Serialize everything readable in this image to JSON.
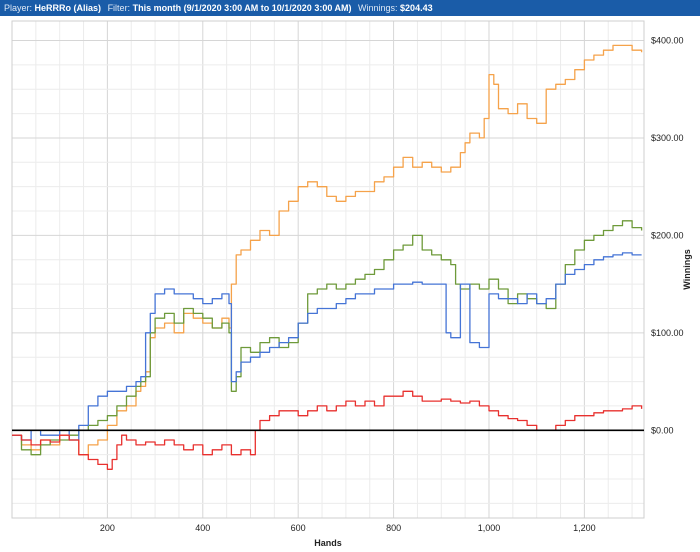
{
  "header": {
    "player_label": "Player:",
    "player_value": "HeRRRo (Alias)",
    "filter_label": "Filter:",
    "filter_value": "This month (9/1/2020 3:00 AM to 10/1/2020 3:00 AM)",
    "winnings_label": "Winnings:",
    "winnings_value": "$204.43"
  },
  "colors": {
    "header_bg": "#1a5ca8",
    "orange": "#f5a24a",
    "green": "#6e9a3a",
    "blue": "#4574d6",
    "red": "#e8302e",
    "zero_line": "#000000"
  },
  "chart_data": {
    "type": "line",
    "xlabel": "Hands",
    "ylabel": "Winnings",
    "xlim": [
      0,
      1325
    ],
    "ylim": [
      -90,
      420
    ],
    "x_ticks": [
      200,
      400,
      600,
      800,
      1000,
      1200
    ],
    "x_tick_labels": [
      "200",
      "400",
      "600",
      "800",
      "1,000",
      "1,200"
    ],
    "y_ticks": [
      0,
      100,
      200,
      300,
      400
    ],
    "y_tick_labels": [
      "$0.00",
      "$100.00",
      "$200.00",
      "$300.00",
      "$400.00"
    ],
    "grid": true,
    "y_axis_side": "right",
    "series": [
      {
        "color": "#f5a24a",
        "x": [
          0,
          20,
          40,
          60,
          80,
          100,
          120,
          140,
          160,
          180,
          200,
          220,
          240,
          260,
          270,
          280,
          290,
          300,
          320,
          340,
          360,
          380,
          400,
          420,
          440,
          455,
          460,
          470,
          480,
          500,
          520,
          540,
          560,
          580,
          600,
          620,
          640,
          660,
          680,
          700,
          720,
          740,
          760,
          780,
          800,
          820,
          840,
          860,
          880,
          900,
          920,
          940,
          950,
          960,
          980,
          990,
          1000,
          1010,
          1020,
          1040,
          1060,
          1080,
          1100,
          1120,
          1140,
          1160,
          1180,
          1200,
          1220,
          1240,
          1260,
          1280,
          1300,
          1320
        ],
        "y": [
          -5,
          -15,
          -20,
          -10,
          -15,
          -5,
          -10,
          -25,
          -15,
          -10,
          5,
          20,
          25,
          40,
          45,
          60,
          95,
          105,
          110,
          100,
          120,
          115,
          110,
          105,
          115,
          105,
          150,
          180,
          185,
          195,
          205,
          200,
          225,
          235,
          250,
          255,
          250,
          240,
          235,
          240,
          245,
          245,
          255,
          260,
          270,
          280,
          270,
          275,
          270,
          265,
          270,
          285,
          295,
          305,
          300,
          320,
          365,
          355,
          330,
          325,
          335,
          320,
          315,
          350,
          355,
          360,
          370,
          380,
          385,
          390,
          395,
          395,
          390,
          388
        ]
      },
      {
        "color": "#6e9a3a",
        "x": [
          0,
          20,
          40,
          60,
          80,
          100,
          120,
          140,
          160,
          180,
          200,
          220,
          240,
          260,
          270,
          280,
          290,
          300,
          320,
          340,
          360,
          380,
          400,
          420,
          440,
          455,
          460,
          470,
          480,
          500,
          520,
          540,
          560,
          580,
          600,
          620,
          640,
          660,
          680,
          700,
          720,
          740,
          760,
          780,
          800,
          820,
          840,
          860,
          880,
          900,
          920,
          930,
          940,
          960,
          980,
          1000,
          1020,
          1040,
          1060,
          1080,
          1100,
          1120,
          1140,
          1160,
          1180,
          1200,
          1220,
          1240,
          1260,
          1280,
          1300,
          1320
        ],
        "y": [
          -5,
          -20,
          -25,
          -15,
          -10,
          -10,
          -5,
          0,
          5,
          10,
          15,
          25,
          35,
          45,
          50,
          55,
          100,
          115,
          120,
          110,
          125,
          120,
          115,
          105,
          110,
          100,
          40,
          55,
          85,
          80,
          90,
          95,
          85,
          90,
          110,
          140,
          145,
          150,
          145,
          150,
          155,
          160,
          165,
          175,
          185,
          190,
          200,
          185,
          180,
          175,
          170,
          150,
          145,
          150,
          145,
          155,
          145,
          130,
          140,
          135,
          130,
          125,
          150,
          170,
          185,
          195,
          200,
          205,
          210,
          215,
          208,
          205
        ]
      },
      {
        "color": "#4574d6",
        "x": [
          0,
          20,
          40,
          60,
          80,
          100,
          120,
          140,
          160,
          180,
          200,
          220,
          240,
          260,
          270,
          280,
          290,
          300,
          320,
          340,
          360,
          380,
          400,
          420,
          440,
          455,
          460,
          470,
          480,
          500,
          520,
          540,
          560,
          580,
          600,
          620,
          640,
          660,
          680,
          700,
          720,
          740,
          760,
          780,
          800,
          820,
          840,
          860,
          880,
          900,
          910,
          920,
          940,
          960,
          980,
          1000,
          1020,
          1040,
          1060,
          1080,
          1100,
          1120,
          1140,
          1160,
          1180,
          1200,
          1220,
          1240,
          1260,
          1280,
          1300,
          1320
        ],
        "y": [
          -5,
          -10,
          0,
          -5,
          -5,
          0,
          -10,
          5,
          25,
          35,
          40,
          40,
          45,
          50,
          55,
          100,
          120,
          140,
          145,
          140,
          140,
          135,
          130,
          135,
          140,
          130,
          50,
          60,
          70,
          75,
          80,
          85,
          90,
          95,
          110,
          120,
          125,
          125,
          130,
          135,
          140,
          140,
          145,
          145,
          150,
          150,
          152,
          150,
          150,
          150,
          100,
          95,
          150,
          90,
          85,
          140,
          135,
          135,
          130,
          140,
          130,
          135,
          150,
          160,
          165,
          170,
          175,
          178,
          180,
          182,
          180,
          180
        ]
      },
      {
        "color": "#e8302e",
        "x": [
          0,
          20,
          40,
          60,
          80,
          100,
          120,
          140,
          160,
          180,
          200,
          210,
          220,
          230,
          240,
          260,
          280,
          300,
          320,
          340,
          360,
          380,
          400,
          420,
          440,
          460,
          480,
          500,
          510,
          520,
          540,
          560,
          580,
          600,
          620,
          640,
          660,
          680,
          700,
          720,
          740,
          760,
          780,
          800,
          820,
          840,
          860,
          880,
          900,
          920,
          940,
          960,
          980,
          1000,
          1020,
          1040,
          1060,
          1080,
          1100,
          1120,
          1140,
          1160,
          1180,
          1200,
          1220,
          1240,
          1260,
          1280,
          1300,
          1320
        ],
        "y": [
          -5,
          -10,
          -15,
          -10,
          -12,
          -5,
          -10,
          -25,
          -30,
          -35,
          -40,
          -30,
          -15,
          -5,
          -10,
          -15,
          -12,
          -15,
          -10,
          -15,
          -20,
          -15,
          -25,
          -20,
          -15,
          -25,
          -20,
          -25,
          0,
          10,
          15,
          20,
          20,
          15,
          20,
          25,
          20,
          25,
          30,
          25,
          30,
          25,
          35,
          35,
          40,
          35,
          30,
          30,
          32,
          30,
          28,
          30,
          25,
          20,
          15,
          12,
          10,
          5,
          0,
          0,
          5,
          10,
          15,
          15,
          18,
          20,
          20,
          22,
          25,
          22
        ]
      }
    ]
  }
}
